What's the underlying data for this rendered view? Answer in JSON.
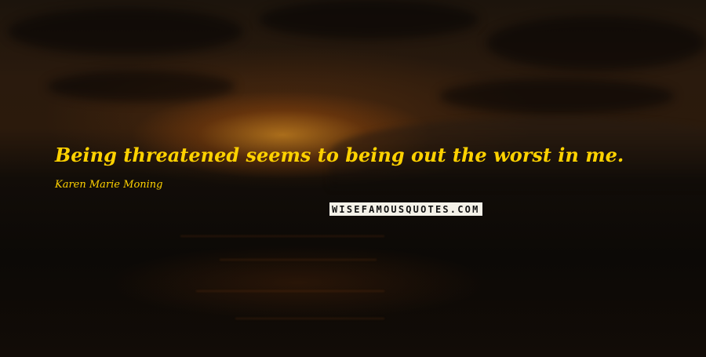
{
  "quote": {
    "text": "Being threatened seems to being out the worst in me."
  },
  "author": {
    "name": "Karen Marie Moning"
  },
  "logo": {
    "text": "WISEFAMOUSQUOTES.COM"
  },
  "colors": {
    "quote_text": "#ffd200",
    "background": "#0b0805",
    "logo_bg": "#f4f1e8"
  }
}
